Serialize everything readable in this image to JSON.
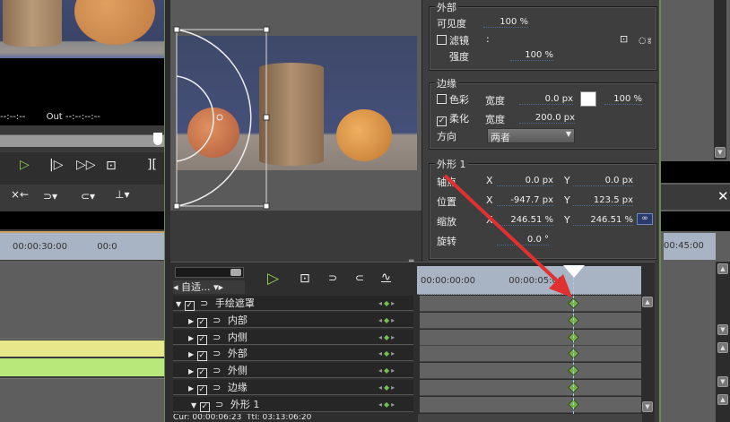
{
  "left_panel": {
    "timecode_in": "--:--:--",
    "timecode_out_label": "Out",
    "timecode_out": "--:--:--:--",
    "ruler_label": "00:00:30:00",
    "ruler_label2": "00:0"
  },
  "settings": {
    "outer": {
      "title": "外部",
      "visibility_label": "可见度",
      "visibility": "100 %",
      "filter_label": "滤镜",
      "filter_value": ":",
      "filter_checked": false,
      "strength_label": "强度",
      "strength": "100 %"
    },
    "edge": {
      "title": "边缘",
      "color_label": "色彩",
      "color_checked": false,
      "width_label": "宽度",
      "width": "0.0 px",
      "color_swatch": "#ffffff",
      "opacity": "100 %",
      "soft_label": "柔化",
      "soft_checked": true,
      "soft_width_label": "宽度",
      "soft_width": "200.0 px",
      "direction_label": "方向",
      "direction": "两者"
    },
    "shape": {
      "title": "外形 1",
      "anchor_label": "轴点",
      "anchor_x": "0.0 px",
      "anchor_y": "0.0 px",
      "pos_label": "位置",
      "pos_x": "-947.7 px",
      "pos_y": "123.5 px",
      "scale_label": "缩放",
      "scale_x": "246.51 %",
      "scale_y": "246.51 %",
      "rot_label": "旋转",
      "rot": "0.0 °",
      "x": "X",
      "y": "Y"
    }
  },
  "keyframe": {
    "zoom_select": "自适...",
    "ruler_start": "00:00:00:00",
    "ruler_mark": "00:00:05:00",
    "layers": [
      {
        "name": "手绘遮罩",
        "expanded": true
      },
      {
        "name": "内部",
        "expanded": false
      },
      {
        "name": "内侧",
        "expanded": false
      },
      {
        "name": "外部",
        "expanded": false
      },
      {
        "name": "外侧",
        "expanded": false
      },
      {
        "name": "边缘",
        "expanded": false
      },
      {
        "name": "外形 1",
        "expanded": true
      }
    ],
    "status": "Cur: 00:00:06:23  Ttl: 03:13:06:20"
  },
  "right_panel": {
    "ruler_label": "00:45:00",
    "close": "✕"
  },
  "colors": {
    "accent_green": "#6fc34a",
    "arrow": "#e03030"
  }
}
